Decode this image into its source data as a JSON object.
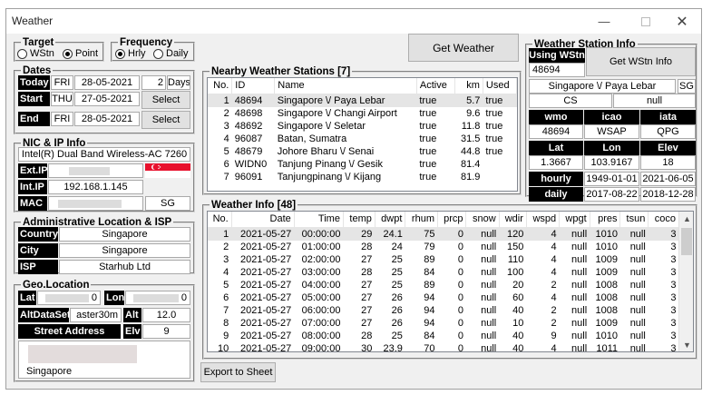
{
  "window": {
    "title": "Weather"
  },
  "target": {
    "legend": "Target",
    "options": [
      "WStn",
      "Point"
    ],
    "selected": "Point"
  },
  "frequency": {
    "legend": "Frequency",
    "options": [
      "Hrly",
      "Daily"
    ],
    "selected": "Hrly"
  },
  "dates": {
    "legend": "Dates",
    "today": {
      "label": "Today",
      "dow": "FRI",
      "date": "28-05-2021",
      "days": "2",
      "days_label": "Days"
    },
    "start": {
      "label": "Start",
      "dow": "THU",
      "date": "27-05-2021",
      "button": "Select"
    },
    "end": {
      "label": "End",
      "dow": "FRI",
      "date": "28-05-2021",
      "button": "Select"
    }
  },
  "nic": {
    "legend": "NIC & IP Info",
    "adapter": "Intel(R) Dual Band Wireless-AC 7260",
    "ext_ip_label": "Ext.IP",
    "int_ip_label": "Int.IP",
    "int_ip": "192.168.1.145",
    "mac_label": "MAC",
    "country_code": "SG"
  },
  "admin": {
    "legend": "Administrative Location & ISP",
    "country_label": "Country",
    "country": "Singapore",
    "city_label": "City",
    "city": "Singapore",
    "isp_label": "ISP",
    "isp": "Starhub Ltd"
  },
  "geo": {
    "legend": "Geo.Location",
    "lat_label": "Lat",
    "lat_suffix": "0",
    "lon_label": "Lon",
    "lon_suffix": "0",
    "altdataset_label": "AltDataSet",
    "altdataset": "aster30m",
    "alt_label": "Alt",
    "alt": "12.0",
    "street_label": "Street Address",
    "elv_label": "Elv",
    "elv": "9",
    "address_last": "Singapore"
  },
  "buttons": {
    "get_weather": "Get Weather",
    "get_wstn_info": "Get WStn Info",
    "export": "Export to Sheet"
  },
  "nearby": {
    "legend": "Nearby Weather Stations [7]",
    "columns": [
      "No.",
      "ID",
      "Name",
      "Active",
      "km",
      "Used"
    ],
    "rows": [
      [
        "1",
        "48694",
        "Singapore \\/ Paya Lebar",
        "true",
        "5.7",
        "true"
      ],
      [
        "2",
        "48698",
        "Singapore \\/ Changi Airport",
        "true",
        "9.6",
        "true"
      ],
      [
        "3",
        "48692",
        "Singapore \\/ Seletar",
        "true",
        "11.8",
        "true"
      ],
      [
        "4",
        "96087",
        "Batan, Sumatra",
        "true",
        "31.5",
        "true"
      ],
      [
        "5",
        "48679",
        "Johore Bharu \\/ Senai",
        "true",
        "44.8",
        "true"
      ],
      [
        "6",
        "WIDN0",
        "Tanjung Pinang \\/ Gesik",
        "true",
        "81.4",
        ""
      ],
      [
        "7",
        "96091",
        "Tanjungpinang \\/ Kijang",
        "true",
        "81.9",
        ""
      ]
    ]
  },
  "station_info": {
    "legend": "Weather Station Info",
    "using_label": "Using WStn",
    "using_id": "48694",
    "name": "Singapore \\/ Paya Lebar",
    "country": "SG",
    "cs": "CS",
    "cs_value": "null",
    "wmo_label": "wmo",
    "icao_label": "icao",
    "iata_label": "iata",
    "wmo": "48694",
    "icao": "WSAP",
    "iata": "QPG",
    "lat_label": "Lat",
    "lon_label": "Lon",
    "elev_label": "Elev",
    "lat": "1.3667",
    "lon": "103.9167",
    "elev": "18",
    "hourly_label": "hourly",
    "hourly_from": "1949-01-01",
    "hourly_to": "2021-06-05",
    "daily_label": "daily",
    "daily_from": "2017-08-22",
    "daily_to": "2018-12-28"
  },
  "weather": {
    "legend": "Weather Info [48]",
    "columns": [
      "No.",
      "Date",
      "Time",
      "temp",
      "dwpt",
      "rhum",
      "prcp",
      "snow",
      "wdir",
      "wspd",
      "wpgt",
      "pres",
      "tsun",
      "coco"
    ],
    "rows": [
      [
        "1",
        "2021-05-27",
        "00:00:00",
        "29",
        "24.1",
        "75",
        "0",
        "null",
        "120",
        "4",
        "null",
        "1010",
        "null",
        "3"
      ],
      [
        "2",
        "2021-05-27",
        "01:00:00",
        "28",
        "24",
        "79",
        "0",
        "null",
        "150",
        "4",
        "null",
        "1010",
        "null",
        "3"
      ],
      [
        "3",
        "2021-05-27",
        "02:00:00",
        "27",
        "25",
        "89",
        "0",
        "null",
        "110",
        "4",
        "null",
        "1009",
        "null",
        "3"
      ],
      [
        "4",
        "2021-05-27",
        "03:00:00",
        "28",
        "25",
        "84",
        "0",
        "null",
        "100",
        "4",
        "null",
        "1009",
        "null",
        "3"
      ],
      [
        "5",
        "2021-05-27",
        "04:00:00",
        "27",
        "25",
        "89",
        "0",
        "null",
        "20",
        "2",
        "null",
        "1008",
        "null",
        "3"
      ],
      [
        "6",
        "2021-05-27",
        "05:00:00",
        "27",
        "26",
        "94",
        "0",
        "null",
        "60",
        "4",
        "null",
        "1008",
        "null",
        "3"
      ],
      [
        "7",
        "2021-05-27",
        "06:00:00",
        "27",
        "26",
        "94",
        "0",
        "null",
        "40",
        "2",
        "null",
        "1008",
        "null",
        "3"
      ],
      [
        "8",
        "2021-05-27",
        "07:00:00",
        "27",
        "26",
        "94",
        "0",
        "null",
        "10",
        "2",
        "null",
        "1009",
        "null",
        "3"
      ],
      [
        "9",
        "2021-05-27",
        "08:00:00",
        "28",
        "25",
        "84",
        "0",
        "null",
        "40",
        "9",
        "null",
        "1010",
        "null",
        "3"
      ],
      [
        "10",
        "2021-05-27",
        "09:00:00",
        "30",
        "23.9",
        "70",
        "0",
        "null",
        "40",
        "4",
        "null",
        "1011",
        "null",
        "3"
      ]
    ]
  }
}
